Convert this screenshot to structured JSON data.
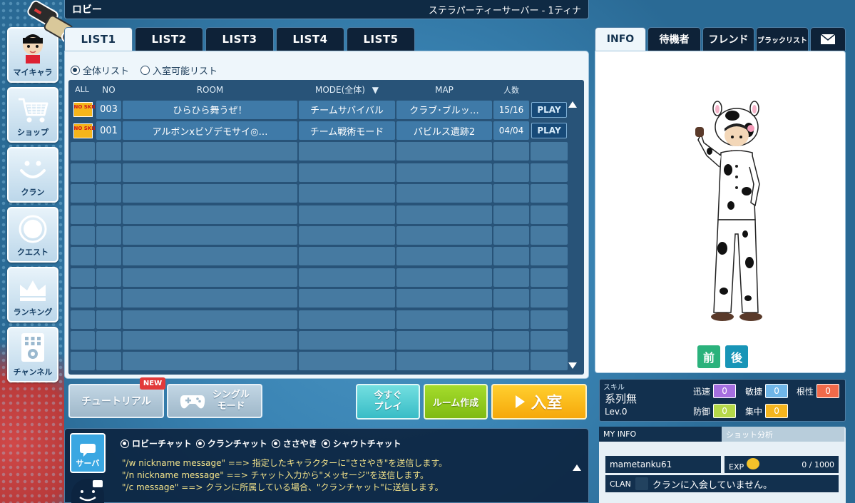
{
  "window": {
    "title": "ロビー",
    "server": "ステラパーティーサーバー - 1ティナ"
  },
  "nav": [
    {
      "label": "マイキャラ",
      "icon": "character-icon"
    },
    {
      "label": "ショップ",
      "icon": "cart-icon"
    },
    {
      "label": "クラン",
      "icon": "smile-icon"
    },
    {
      "label": "クエスト",
      "icon": "circle-icon"
    },
    {
      "label": "ランキング",
      "icon": "crown-icon"
    },
    {
      "label": "チャンネル",
      "icon": "channel-icon"
    }
  ],
  "list_tabs": [
    "LIST1",
    "LIST2",
    "LIST3",
    "LIST4",
    "LIST5"
  ],
  "filters": {
    "all_list": "全体リスト",
    "joinable_list": "入室可能リスト"
  },
  "table": {
    "headers": {
      "all": "ALL",
      "no": "NO",
      "room": "ROOM",
      "mode": "MODE(全体)",
      "map": "MAP",
      "count": "人数"
    },
    "rows": [
      {
        "badge": "NO SKILL",
        "no": "003",
        "room": "ひらひら舞うぜ！",
        "mode": "チームサバイバル",
        "map": "クラブ･ブルッ…",
        "count": "15/16",
        "play": "PLAY"
      },
      {
        "badge": "NO SKILL",
        "no": "001",
        "room": "アルボンxビゾデモサイ◎…",
        "mode": "チーム戦術モード",
        "map": "パビルス遺跡2",
        "count": "04/04",
        "play": "PLAY"
      }
    ]
  },
  "actions": {
    "tutorial": "チュートリアル",
    "new_badge": "NEW",
    "single_mode": "シングル\nモード",
    "play_now": "今すぐ\nプレイ",
    "create_room": "ルーム作成",
    "enter_room": "入室"
  },
  "chat": {
    "server_label": "サーバ",
    "channels": [
      "ロビーチャット",
      "クランチャット",
      "ささやき",
      "シャウトチャット"
    ],
    "lines": [
      "\"/w nickname message\" ==> 指定したキャラクターに\"ささやき\"を送信します。",
      "\"/n nickname message\" ==> チャット入力から\"メッセージ\"を送信します。",
      "\"/c message\" ==> クランに所属している場合、\"クランチャット\"に送信します。"
    ]
  },
  "right_tabs": [
    "INFO",
    "待機者",
    "フレンド",
    "ブラックリスト"
  ],
  "character": {
    "front": "前",
    "back": "後"
  },
  "skill": {
    "label": "スキル",
    "name": "系列無",
    "level": "Lev.0",
    "stats": [
      {
        "name": "迅速",
        "value": "0",
        "color": "#a56fe0"
      },
      {
        "name": "敏捷",
        "value": "0",
        "color": "#6fb6e8"
      },
      {
        "name": "根性",
        "value": "0",
        "color": "#f26a4a"
      },
      {
        "name": "防御",
        "value": "0",
        "color": "#b5d94a"
      },
      {
        "name": "集中",
        "value": "0",
        "color": "#f5b51e"
      }
    ]
  },
  "my_info": {
    "tab_info": "MY INFO",
    "tab_shot": "ショット分析",
    "nickname": "mametanku61",
    "exp_label": "EXP",
    "exp_value": "0 / 1000",
    "clan_label": "CLAN",
    "clan_text": "クランに入会していません。"
  }
}
